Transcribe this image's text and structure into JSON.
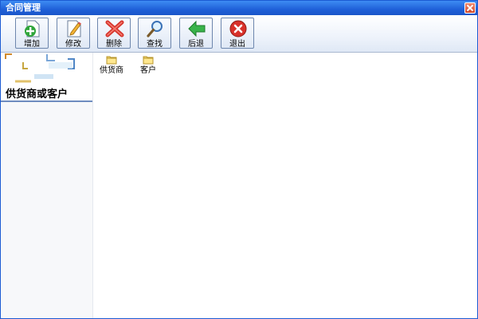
{
  "window": {
    "title": "合同管理"
  },
  "toolbar": {
    "buttons": [
      {
        "label": "增加",
        "icon": "add-document-icon"
      },
      {
        "label": "修改",
        "icon": "edit-document-icon"
      },
      {
        "label": "删除",
        "icon": "delete-x-icon"
      },
      {
        "label": "查找",
        "icon": "magnifier-icon"
      },
      {
        "label": "后退",
        "icon": "back-arrow-icon"
      },
      {
        "label": "退出",
        "icon": "exit-icon"
      }
    ]
  },
  "sidebar": {
    "title": "供货商或客户"
  },
  "main": {
    "items": [
      {
        "label": "供货商",
        "icon": "folder-icon"
      },
      {
        "label": "客户",
        "icon": "folder-icon"
      }
    ]
  }
}
